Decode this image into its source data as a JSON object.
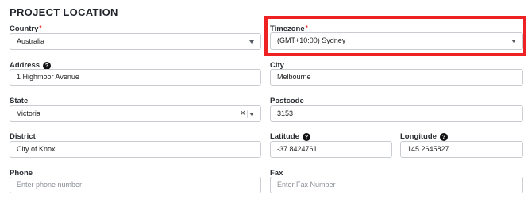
{
  "section": {
    "title": "PROJECT LOCATION"
  },
  "colors": {
    "highlight": "#ee2222",
    "required": "#e02424",
    "border": "#c9cdd2"
  },
  "icons": {
    "help": "question-circle-icon",
    "dropdown": "chevron-down-icon",
    "clear": "close-icon"
  },
  "fields": {
    "country": {
      "label": "Country",
      "required_mark": "*",
      "value": "Australia"
    },
    "timezone": {
      "label": "Timezone",
      "required_mark": "*",
      "value": "(GMT+10:00) Sydney"
    },
    "address": {
      "label": "Address",
      "help": "?",
      "value": "1 Highmoor Avenue"
    },
    "city": {
      "label": "City",
      "value": "Melbourne"
    },
    "state": {
      "label": "State",
      "value": "Victoria",
      "clear": "×"
    },
    "postcode": {
      "label": "Postcode",
      "value": "3153"
    },
    "district": {
      "label": "District",
      "value": "City of Knox"
    },
    "latitude": {
      "label": "Latitude",
      "help": "?",
      "value": "-37.8424761"
    },
    "longitude": {
      "label": "Longitude",
      "help": "?",
      "value": "145.2645827"
    },
    "phone": {
      "label": "Phone",
      "placeholder": "Enter phone number"
    },
    "fax": {
      "label": "Fax",
      "placeholder": "Enter Fax Number"
    }
  }
}
